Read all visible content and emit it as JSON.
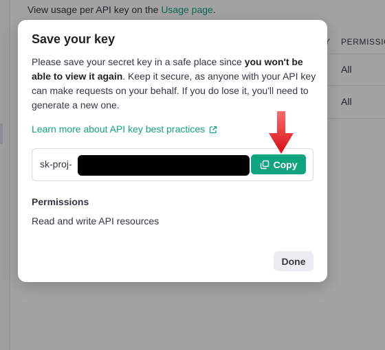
{
  "background": {
    "usage_text": "View usage per API key on the ",
    "usage_link": "Usage page",
    "usage_tail": ".",
    "col_header_cut": "Y",
    "col_header": "PERMISSIONS",
    "rows": [
      "All",
      "All"
    ]
  },
  "modal": {
    "title": "Save your key",
    "desc_part1": "Please save your secret key in a safe place since ",
    "desc_bold": "you won't be able to view it again",
    "desc_part2": ". Keep it secure, as anyone with your API key can make requests on your behalf. If you do lose it, you'll need to generate a new one.",
    "learn_link": "Learn more about API key best practices",
    "key_prefix": "sk-proj-",
    "copy_label": "Copy",
    "permissions_label": "Permissions",
    "permissions_value": "Read and write API resources",
    "done_label": "Done"
  },
  "icons": {
    "external_link": "external-link-icon",
    "copy": "copy-icon"
  },
  "colors": {
    "accent": "#10a37f",
    "annotation_arrow": "#e8141b"
  }
}
